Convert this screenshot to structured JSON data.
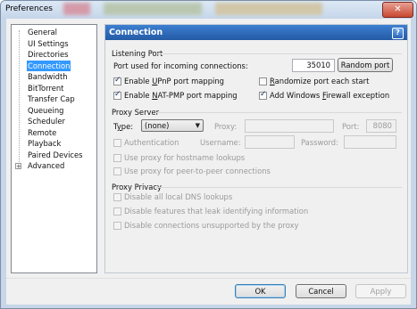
{
  "window": {
    "title": "Preferences",
    "close_glyph": "✕"
  },
  "tree": {
    "items": [
      {
        "label": "General"
      },
      {
        "label": "UI Settings"
      },
      {
        "label": "Directories"
      },
      {
        "label": "Connection",
        "selected": true
      },
      {
        "label": "Bandwidth"
      },
      {
        "label": "BitTorrent"
      },
      {
        "label": "Transfer Cap"
      },
      {
        "label": "Queueing"
      },
      {
        "label": "Scheduler"
      },
      {
        "label": "Remote"
      },
      {
        "label": "Playback"
      },
      {
        "label": "Paired Devices"
      },
      {
        "label": "Advanced",
        "expandable": true
      }
    ],
    "expander_glyph": "+"
  },
  "panel": {
    "title": "Connection",
    "help_glyph": "?",
    "listening": {
      "group_label": "Listening Port",
      "port_label": "Port used for incoming connections:",
      "port_value": "35010",
      "random_port_button": "Random port",
      "upnp_label": "Enable UPnP port mapping",
      "upnp_checked": true,
      "natpmp_label": "Enable NAT-PMP port mapping",
      "natpmp_checked": true,
      "randomize_label": "Randomize port each start",
      "randomize_checked": false,
      "firewall_label": "Add Windows Firewall exception",
      "firewall_checked": true
    },
    "proxy": {
      "group_label": "Proxy Server",
      "type_label": "Type:",
      "type_value": "(none)",
      "proxy_label": "Proxy:",
      "port_label": "Port:",
      "port_value": "8080",
      "auth_label": "Authentication",
      "username_label": "Username:",
      "password_label": "Password:",
      "hostname_label": "Use proxy for hostname lookups",
      "p2p_label": "Use proxy for peer-to-peer connections"
    },
    "privacy": {
      "group_label": "Proxy Privacy",
      "dns_label": "Disable all local DNS lookups",
      "leak_label": "Disable features that leak identifying information",
      "unsupported_label": "Disable connections unsupported by the proxy"
    }
  },
  "buttons": {
    "ok": "OK",
    "cancel": "Cancel",
    "apply": "Apply"
  }
}
